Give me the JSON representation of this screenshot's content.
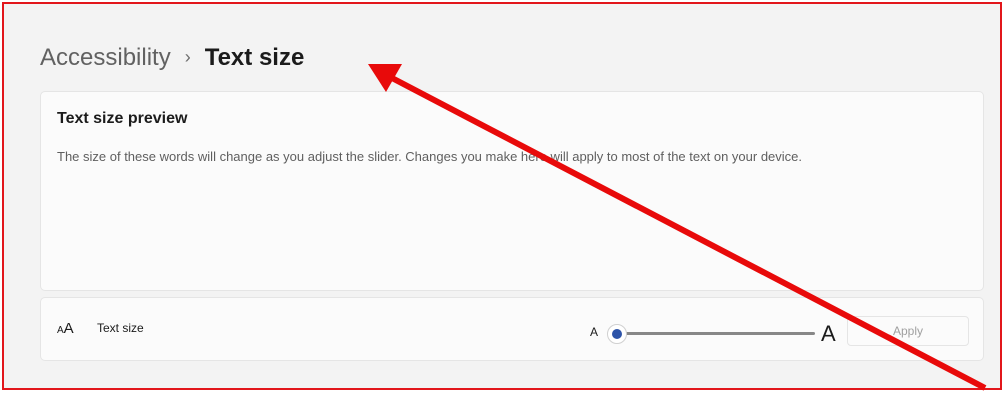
{
  "breadcrumb": {
    "parent": "Accessibility",
    "separator": "›",
    "current": "Text size"
  },
  "preview": {
    "title": "Text size preview",
    "description": "The size of these words will change as you adjust the slider. Changes you make here will apply to most of the text on your device."
  },
  "text_size_setting": {
    "label": "Text size",
    "icon": "text-size-icon",
    "icon_small_glyph": "A",
    "icon_big_glyph": "A",
    "slider_min_label": "A",
    "slider_max_label": "A",
    "slider_value_fraction": 0.0,
    "apply_label": "Apply",
    "apply_enabled": false
  },
  "colors": {
    "frame_border": "#e2161b",
    "annotation_arrow": "#e80a0a",
    "slider_accent": "#2d53a8",
    "background": "#f3f3f3",
    "card": "#fbfbfb"
  }
}
